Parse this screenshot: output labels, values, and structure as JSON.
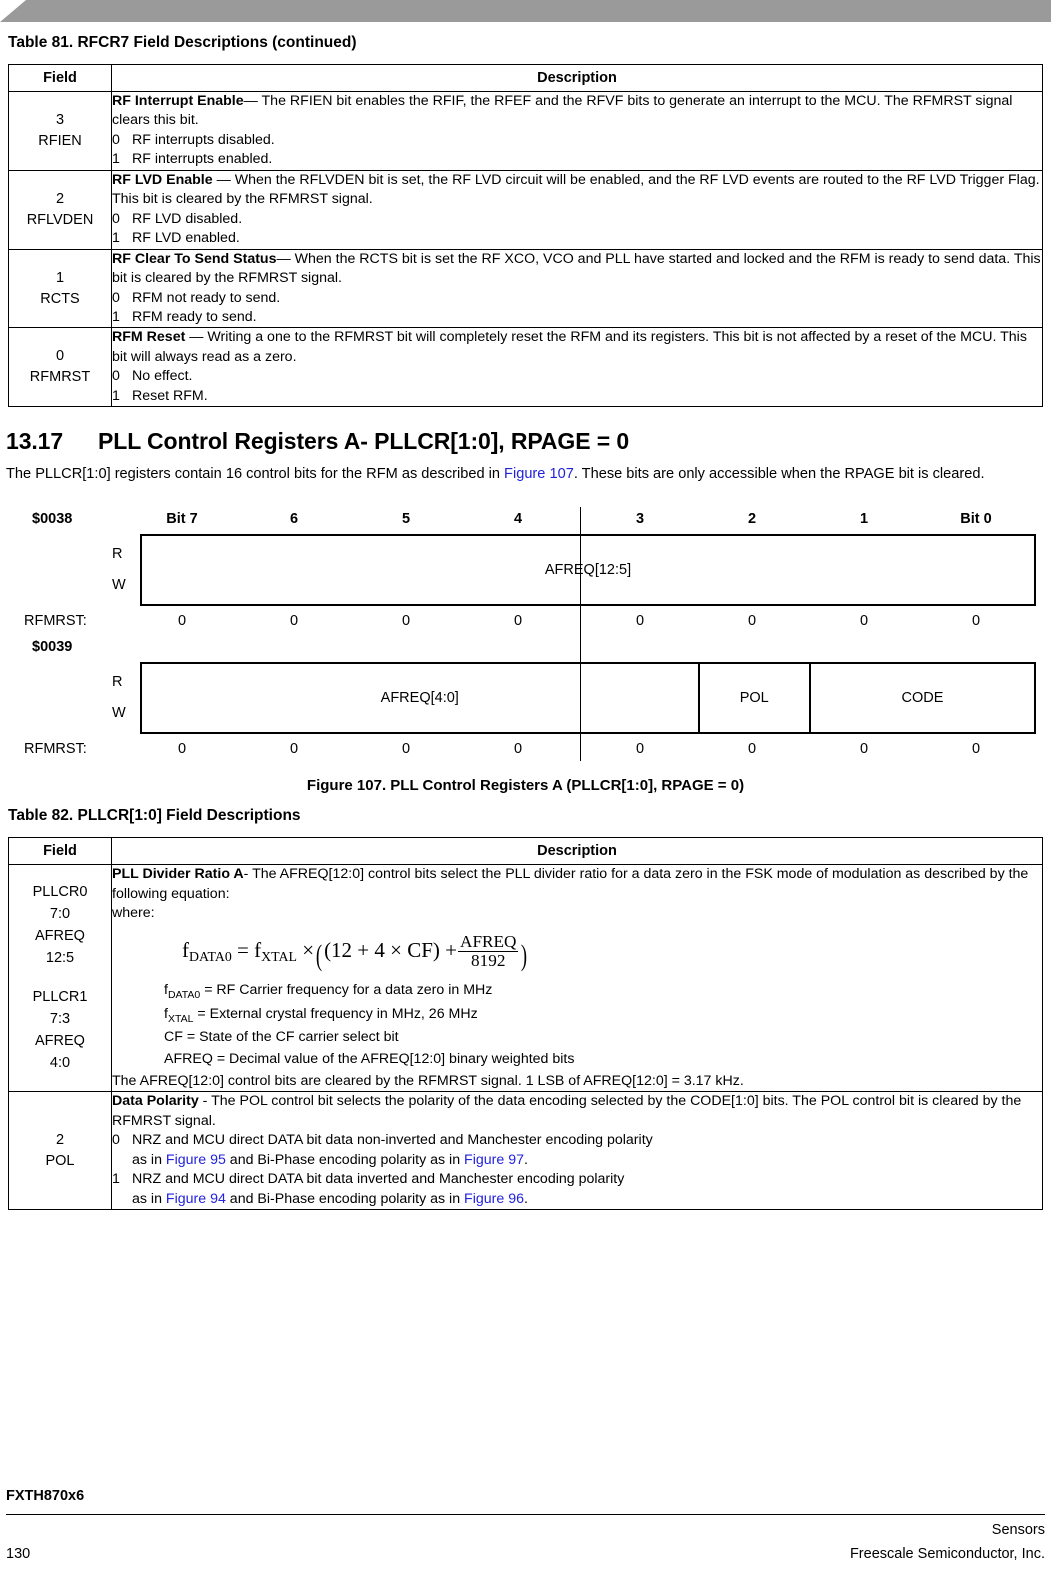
{
  "document": {
    "part_number": "FXTH870x6",
    "page_number": "130",
    "footer_line1": "Sensors",
    "footer_line2": "Freescale Semiconductor, Inc."
  },
  "table81": {
    "caption": "Table 81. RFCR7 Field Descriptions (continued)",
    "headers": [
      "Field",
      "Description"
    ],
    "rows": [
      {
        "field_bit": "3",
        "field_name": "RFIEN",
        "title": "RF Interrupt Enable",
        "body": "— The RFIEN bit enables the RFIF, the RFEF and the RFVF bits to generate an interrupt to the MCU. The RFMRST signal clears this bit.",
        "options": [
          {
            "value": "0",
            "text": "RF interrupts disabled."
          },
          {
            "value": "1",
            "text": "RF interrupts enabled."
          }
        ]
      },
      {
        "field_bit": "2",
        "field_name": "RFLVDEN",
        "title": "RF LVD Enable",
        "body": " — When the RFLVDEN bit is set, the RF LVD circuit will be enabled, and the RF LVD events are routed to the RF LVD Trigger Flag. This bit is cleared by the RFMRST signal.",
        "options": [
          {
            "value": "0",
            "text": "RF LVD disabled."
          },
          {
            "value": "1",
            "text": "RF LVD enabled."
          }
        ]
      },
      {
        "field_bit": "1",
        "field_name": "RCTS",
        "title": "RF Clear To Send Status",
        "body": "— When the RCTS bit is set the RF XCO, VCO and PLL have started and locked and the RFM is ready to send data. This bit is cleared by the RFMRST signal.",
        "options": [
          {
            "value": "0",
            "text": "RFM not ready to send."
          },
          {
            "value": "1",
            "text": "RFM ready to send."
          }
        ]
      },
      {
        "field_bit": "0",
        "field_name": "RFMRST",
        "title": "RFM Reset",
        "body": " — Writing a one to the RFMRST bit will completely reset the RFM and its registers. This bit is not affected by a reset of the MCU. This bit will always read as a zero.",
        "options": [
          {
            "value": "0",
            "text": "No effect."
          },
          {
            "value": "1",
            "text": "Reset RFM."
          }
        ]
      }
    ]
  },
  "section": {
    "number": "13.17",
    "title": "PLL Control Registers A- PLLCR[1:0], RPAGE = 0",
    "body_before_xref": "The PLLCR[1:0] registers contain 16 control bits for the RFM as described in ",
    "xref": "Figure 107",
    "body_after_xref": ". These bits are only accessible when the RPAGE bit is cleared."
  },
  "figure107": {
    "caption": "Figure 107. PLL Control Registers A (PLLCR[1:0], RPAGE = 0)",
    "bit_headers": [
      "Bit 7",
      "6",
      "5",
      "4",
      "3",
      "2",
      "1",
      "Bit 0"
    ],
    "read_label": "R",
    "write_label": "W",
    "reset_label": "RFMRST:",
    "registers": [
      {
        "address": "$0038",
        "fields": [
          {
            "name": "AFREQ[12:5]",
            "span": 8
          }
        ],
        "reset_values": [
          "0",
          "0",
          "0",
          "0",
          "0",
          "0",
          "0",
          "0"
        ]
      },
      {
        "address": "$0039",
        "fields": [
          {
            "name": "AFREQ[4:0]",
            "span": 5
          },
          {
            "name": "POL",
            "span": 1
          },
          {
            "name": "CODE",
            "span": 2
          }
        ],
        "reset_values": [
          "0",
          "0",
          "0",
          "0",
          "0",
          "0",
          "0",
          "0"
        ]
      }
    ]
  },
  "table82": {
    "caption": "Table 82. PLLCR[1:0] Field Descriptions",
    "headers": [
      "Field",
      "Description"
    ],
    "row_pllcr": {
      "field_lines": [
        "PLLCR0",
        "7:0",
        "AFREQ",
        "12:5",
        "",
        "PLLCR1",
        "7:3",
        "AFREQ",
        "4:0"
      ],
      "title": "PLL Divider Ratio A",
      "body": "- The AFREQ[12:0] control bits select the PLL divider ratio for a data zero in the FSK mode of modulation as described by the following equation:",
      "where_label": "where:",
      "equation": {
        "lhs_base": "f",
        "lhs_sub": "DATA0",
        "eq": "=",
        "rhs_base": "f",
        "rhs_sub": "XTAL",
        "times": "×",
        "group": "(12 + 4 × CF) +",
        "frac_num": "AFREQ",
        "frac_den": "8192"
      },
      "definitions": [
        {
          "sym": "f",
          "sub": "DATA0",
          "text": " = RF Carrier frequency for a data zero in MHz"
        },
        {
          "sym": "f",
          "sub": "XTAL",
          "text": " = External crystal frequency in MHz, 26 MHz"
        },
        {
          "sym": "CF",
          "sub": "",
          "text": " = State of the CF carrier select bit"
        },
        {
          "sym": "AFREQ",
          "sub": "",
          "text": " = Decimal value of the AFREQ[12:0] binary weighted bits"
        }
      ],
      "closing": "The AFREQ[12:0] control bits are cleared by the RFMRST signal. 1 LSB of AFREQ[12:0] = 3.17 kHz."
    },
    "row_pol": {
      "field_bit": "2",
      "field_name": "POL",
      "title": "Data Polarity",
      "body": " - The POL control bit selects the polarity of the data encoding selected by the CODE[1:0] bits. The POL control bit is cleared by the RFMRST signal.",
      "options": [
        {
          "value": "0",
          "line1": "NRZ and MCU direct DATA bit data non-inverted and Manchester encoding polarity",
          "line2_pre": "as in ",
          "line2_xref1": "Figure 95",
          "line2_mid": " and Bi-Phase encoding polarity as in ",
          "line2_xref2": "Figure 97",
          "line2_post": "."
        },
        {
          "value": "1",
          "line1": "NRZ and MCU direct DATA bit data inverted and Manchester encoding polarity",
          "line2_pre": "as in ",
          "line2_xref1": "Figure 94",
          "line2_mid": " and Bi-Phase encoding polarity as in ",
          "line2_xref2": "Figure 96",
          "line2_post": "."
        }
      ]
    }
  },
  "colors": {
    "banner": "#9a9a9a",
    "xref_link": "#2222dd",
    "text": "#000000"
  }
}
